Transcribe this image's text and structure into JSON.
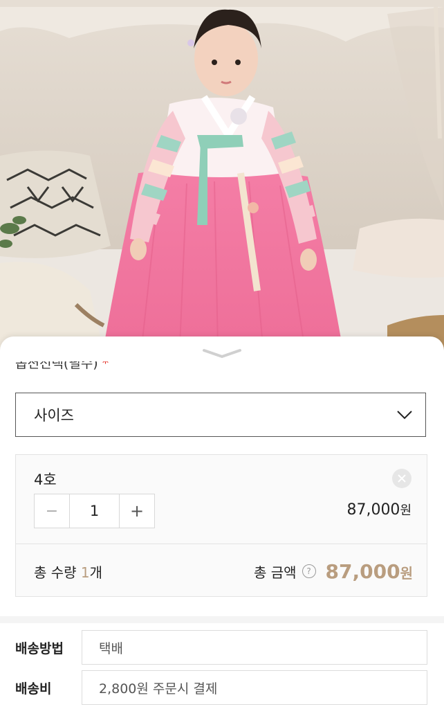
{
  "sheet": {
    "option_label": "옵션선택(필수)",
    "required_mark": "*",
    "size_select": {
      "placeholder": "사이즈",
      "icon": "chevron-down-icon"
    },
    "selected_item": {
      "name": "4호",
      "quantity": "1",
      "price": "87,000",
      "price_unit": "원",
      "minus_symbol": "−",
      "plus_symbol": "+"
    },
    "summary": {
      "total_qty_prefix": "총 수량 ",
      "total_qty_value": "1",
      "total_qty_suffix": "개",
      "total_amount_label": "총 금액",
      "help_symbol": "?",
      "total_amount": "87,000",
      "total_amount_unit": "원"
    },
    "shipping": {
      "method_label": "배송방법",
      "method_value": "택배",
      "fee_label": "배송비",
      "fee_value": "2,800원 주문시 결제"
    }
  },
  "colors": {
    "accent": "#b99d7f",
    "required": "#e2231a",
    "skirt_pink": "#f07aa0"
  }
}
